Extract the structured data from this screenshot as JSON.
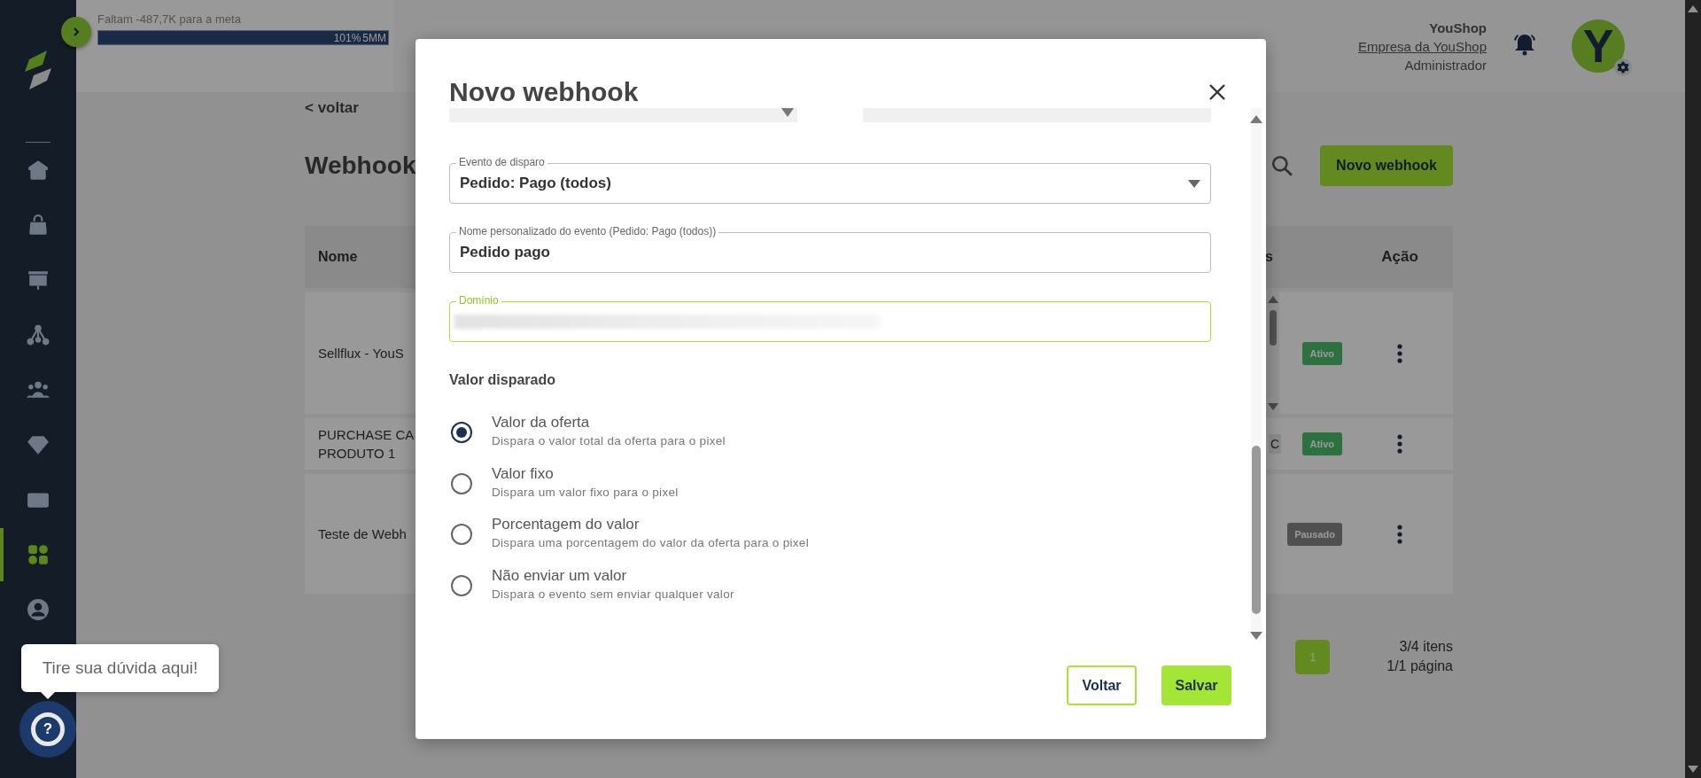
{
  "sidebar": {
    "items": [
      {
        "kind": "home",
        "selected": false
      },
      {
        "kind": "bag",
        "selected": false
      },
      {
        "kind": "board",
        "selected": false
      },
      {
        "kind": "network",
        "selected": false
      },
      {
        "kind": "users",
        "selected": false
      },
      {
        "kind": "diamond",
        "selected": false
      },
      {
        "kind": "money",
        "selected": false
      },
      {
        "kind": "grid",
        "selected": true
      },
      {
        "kind": "user",
        "selected": false
      }
    ]
  },
  "header": {
    "goal_text": "Faltam -487,7K para a meta",
    "progress": {
      "level": 1,
      "percent": "101%",
      "target": "5MM"
    },
    "company_name": "YouShop",
    "company_link": "Empresa da YouShop",
    "role": "Administrador",
    "avatar_letter": "Y"
  },
  "page": {
    "back_link": "< voltar",
    "title": "Webhook",
    "new_button": "Novo webhook",
    "table": {
      "columns": [
        "Nome",
        "s",
        "Ação"
      ],
      "rows": [
        {
          "name": [
            "Sellflux - YouS"
          ],
          "tag": "",
          "status": "Ativo",
          "kind": "active",
          "cell_scroll": true
        },
        {
          "name": [
            "PURCHASE CA",
            "PRODUTO 1"
          ],
          "tag": "C",
          "status": "Ativo",
          "kind": "active",
          "cell_scroll": false
        },
        {
          "name": [
            "Teste de Webh"
          ],
          "tag": "",
          "status": "Pausado",
          "kind": "paused",
          "cell_scroll": false
        }
      ]
    },
    "pagination": {
      "pages": [
        {
          "label": "1",
          "selected": true
        }
      ],
      "items": "3/4 itens",
      "page_info": "1/1 página"
    }
  },
  "modal": {
    "title": "Novo webhook",
    "cut_fields": [
      {
        "kind": "select"
      },
      {
        "kind": "text"
      }
    ],
    "fields": [
      {
        "kind": "select",
        "label": "Evento de disparo",
        "value": "Pedido: Pago (todos)",
        "focused": false
      },
      {
        "kind": "text",
        "label": "Nome personalizado do evento (Pedido: Pago (todos))",
        "value": "Pedido pago",
        "focused": false
      },
      {
        "kind": "redacted",
        "label": "Domínio",
        "focused": true
      }
    ],
    "value_section": {
      "title": "Valor disparado",
      "options": [
        {
          "label": "Valor da oferta",
          "description": "Dispara o valor total da oferta para o pixel",
          "selected": true
        },
        {
          "label": "Valor fixo",
          "description": "Dispara um valor fixo para o pixel",
          "selected": false
        },
        {
          "label": "Porcentagem do valor",
          "description": "Dispara uma porcentagem do valor da oferta para o pixel",
          "selected": false
        },
        {
          "label": "Não enviar um valor",
          "description": "Dispara o evento sem enviar qualquer valor",
          "selected": false
        }
      ]
    },
    "buttons": [
      {
        "label": "Voltar",
        "kind": "outline"
      },
      {
        "label": "Salvar",
        "kind": "primary"
      }
    ]
  },
  "help": {
    "tooltip": "Tire sua dúvida aqui!",
    "button_label": "?"
  }
}
